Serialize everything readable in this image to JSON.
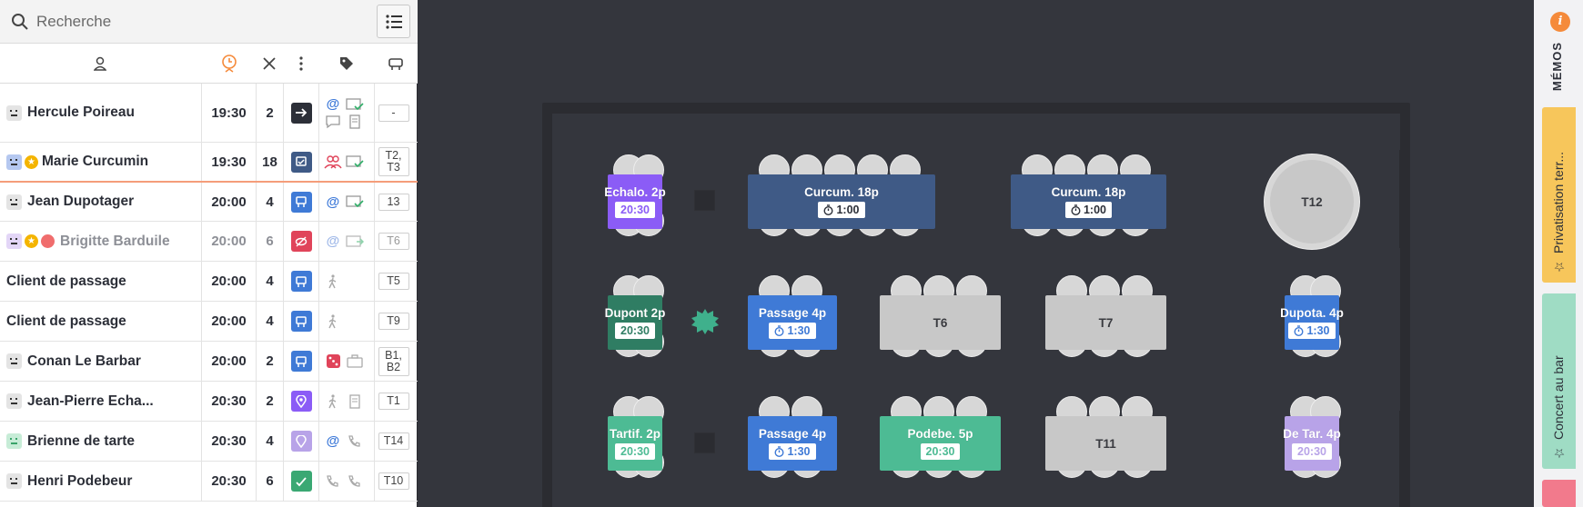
{
  "search": {
    "placeholder": "Recherche"
  },
  "reservations": [
    {
      "name": "Hercule Poireau",
      "time": "19:30",
      "covers": "2",
      "table": "-",
      "dim": false
    },
    {
      "name": "Marie Curcumin",
      "time": "19:30",
      "covers": "18",
      "table": "T2, T3",
      "dim": false
    },
    {
      "name": "Jean Dupotager",
      "time": "20:00",
      "covers": "4",
      "table": "13",
      "dim": false
    },
    {
      "name": "Brigitte Barduile",
      "time": "20:00",
      "covers": "6",
      "table": "T6",
      "dim": true
    },
    {
      "name": "Client de passage",
      "time": "20:00",
      "covers": "4",
      "table": "T5",
      "dim": false
    },
    {
      "name": "Client de passage",
      "time": "20:00",
      "covers": "4",
      "table": "T9",
      "dim": false
    },
    {
      "name": "Conan Le Barbar",
      "time": "20:00",
      "covers": "2",
      "table": "B1, B2",
      "dim": false
    },
    {
      "name": "Jean-Pierre Echa...",
      "time": "20:30",
      "covers": "2",
      "table": "T1",
      "dim": false
    },
    {
      "name": "Brienne de tarte",
      "time": "20:30",
      "covers": "4",
      "table": "T14",
      "dim": false
    },
    {
      "name": "Henri Podebeur",
      "time": "20:30",
      "covers": "6",
      "table": "T10",
      "dim": false
    }
  ],
  "tables": [
    {
      "label": "Echalo. 2p",
      "badge": "20:30",
      "color": "#8b5cf6",
      "badge_color": "#8b5cf6",
      "timer": false
    },
    {
      "label": "Curcum. 18p",
      "badge": "1:00",
      "color": "#3f5a86",
      "badge_color": "#2c2f38",
      "timer": true
    },
    {
      "label": "Curcum. 18p",
      "badge": "1:00",
      "color": "#3f5a86",
      "badge_color": "#2c2f38",
      "timer": true
    },
    {
      "label": "T12",
      "badge": "",
      "color": "#c8c8c8"
    },
    {
      "label": "Dupont 2p",
      "badge": "20:30",
      "color": "#2f7d63",
      "badge_color": "#2f7d63",
      "timer": false
    },
    {
      "label": "Passage 4p",
      "badge": "1:30",
      "color": "#3f7ad6",
      "badge_color": "#3f7ad6",
      "timer": true
    },
    {
      "label": "T6",
      "badge": "",
      "color": "#c8c8c8"
    },
    {
      "label": "T7",
      "badge": "",
      "color": "#c8c8c8"
    },
    {
      "label": "Dupota. 4p",
      "badge": "1:30",
      "color": "#3f7ad6",
      "badge_color": "#3f7ad6",
      "timer": true
    },
    {
      "label": "Tartif. 2p",
      "badge": "20:30",
      "color": "#4dbb94",
      "badge_color": "#4dbb94",
      "timer": false
    },
    {
      "label": "Passage 4p",
      "badge": "1:30",
      "color": "#3f7ad6",
      "badge_color": "#3f7ad6",
      "timer": true
    },
    {
      "label": "Podebe. 5p",
      "badge": "20:30",
      "color": "#4dbb94",
      "badge_color": "#4dbb94",
      "timer": false
    },
    {
      "label": "T11",
      "badge": "",
      "color": "#c8c8c8"
    },
    {
      "label": "De Tar. 4p",
      "badge": "20:30",
      "color": "#b8a3e8",
      "badge_color": "#b8a3e8",
      "timer": false
    }
  ],
  "sidebar": {
    "memos_label": "MÉMOS",
    "tab1_label": "Privatisation terr...",
    "tab2_label": "Concert au bar"
  },
  "colors": {
    "accent_orange": "#f58a3a",
    "dark_bg": "#34363d"
  }
}
